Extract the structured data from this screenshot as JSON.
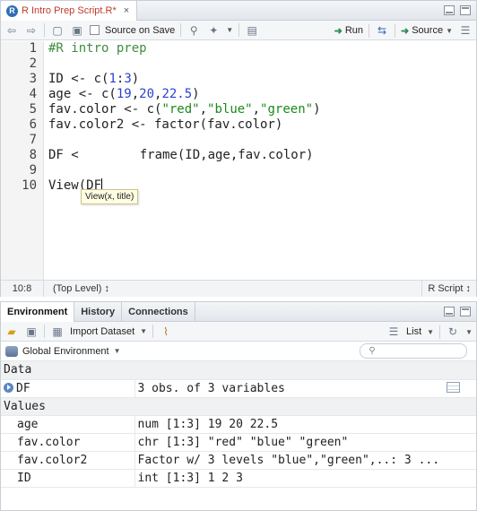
{
  "editor": {
    "tab_title": "R Intro Prep Script.R*",
    "tab_icon": "r-file-icon",
    "toolbar": {
      "source_on_save_label": "Source on Save",
      "run_label": "Run",
      "source_label": "Source"
    },
    "line_numbers": [
      "1",
      "2",
      "3",
      "4",
      "5",
      "6",
      "7",
      "8",
      "9",
      "10"
    ],
    "code": {
      "l1": "#R intro prep",
      "l3a": "ID <- c(",
      "l3b": "1",
      "l3c": ":",
      "l3d": "3",
      "l3e": ")",
      "l4a": "age <- c(",
      "l4b": "19",
      "l4c": ",",
      "l4d": "20",
      "l4e": ",",
      "l4f": "22.5",
      "l4g": ")",
      "l5a": "fav.color <- c(",
      "l5b": "\"red\"",
      "l5c": ",",
      "l5d": "\"blue\"",
      "l5e": ",",
      "l5f": "\"green\"",
      "l5g": ")",
      "l6": "fav.color2 <- factor(fav.color)",
      "l8a": "DF <",
      "l8b": "frame(ID,age,fav.color)",
      "l10": "View(DF"
    },
    "tooltip": "View(x, title)",
    "status": {
      "position": "10:8",
      "scope": "(Top Level) ↕",
      "file_type": "R Script ↕"
    }
  },
  "environment": {
    "tabs": [
      "Environment",
      "History",
      "Connections"
    ],
    "toolbar": {
      "import_label": "Import Dataset",
      "view_mode": "List"
    },
    "scope_label": "Global Environment",
    "sections": {
      "data": "Data",
      "values": "Values"
    },
    "data_rows": [
      {
        "name": "DF",
        "value": "3 obs. of 3 variables"
      }
    ],
    "value_rows": [
      {
        "name": "age",
        "value": "num [1:3] 19 20 22.5"
      },
      {
        "name": "fav.color",
        "value": "chr [1:3] \"red\" \"blue\" \"green\""
      },
      {
        "name": "fav.color2",
        "value": "Factor w/ 3 levels \"blue\",\"green\",..: 3 ..."
      },
      {
        "name": "ID",
        "value": "int [1:3] 1 2 3"
      }
    ]
  }
}
